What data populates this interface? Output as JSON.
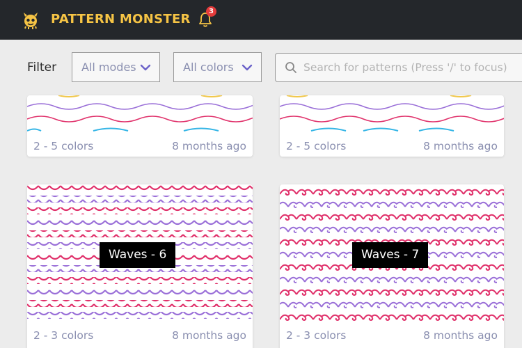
{
  "header": {
    "brand": "PATTERN MONSTER",
    "notification_count": "3",
    "brand_color": "#f6c445",
    "icons": {
      "logo": "monster-logo-icon",
      "bell": "bell-icon"
    }
  },
  "filters": {
    "label": "Filter",
    "modes": {
      "value": "All modes"
    },
    "colors": {
      "value": "All colors"
    },
    "search": {
      "placeholder": "Search for patterns (Press '/' to focus)",
      "value": ""
    }
  },
  "cards": [
    {
      "colors": "2 - 5 colors",
      "time": "8 months ago",
      "title": ""
    },
    {
      "colors": "2 - 5 colors",
      "time": "8 months ago",
      "title": ""
    },
    {
      "colors": "2 - 3 colors",
      "time": "8 months ago",
      "title": "Waves - 6"
    },
    {
      "colors": "2 - 3 colors",
      "time": "8 months ago",
      "title": "Waves - 7"
    }
  ],
  "palette": {
    "purple": "#9a6fd8",
    "pink": "#e0306a",
    "blue": "#37b6e6",
    "yellow": "#f1c84b"
  }
}
